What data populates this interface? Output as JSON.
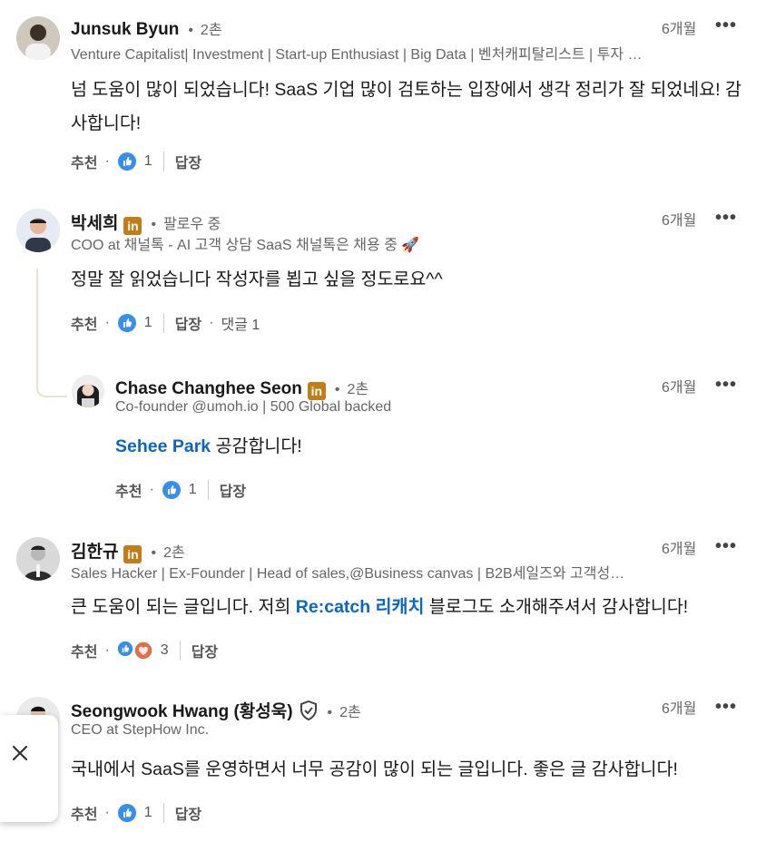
{
  "comments": [
    {
      "name": "Junsuk Byun",
      "degree": "2촌",
      "headline": "Venture Capitalist| Investment | Start-up Enthusiast | Big Data | 벤처캐피탈리스트 | 투자 |...",
      "time": "6개월",
      "body": "넘 도움이 많이 되었습니다! SaaS 기업 많이 검토하는 입장에서 생각 정리가 잘 되었네요! 감사합니다!",
      "like_label": "추천",
      "reaction_count": "1",
      "reply_label": "답장"
    },
    {
      "name": "박세희",
      "degree": "팔로우 중",
      "headline": "COO at 채널톡 - AI 고객 상담 SaaS 채널톡은 채용 중 🚀",
      "time": "6개월",
      "body": "정말 잘 읽었습니다 작성자를 뵙고 싶을 정도로요^^",
      "like_label": "추천",
      "reaction_count": "1",
      "reply_label": "답장",
      "replies_label": "댓글 1"
    },
    {
      "name": "Chase Changhee Seon",
      "degree": "2촌",
      "headline": "Co-founder @umoh.io | 500 Global backed",
      "time": "6개월",
      "mention": "Sehee Park",
      "body": " 공감합니다!",
      "like_label": "추천",
      "reaction_count": "1",
      "reply_label": "답장"
    },
    {
      "name": "김한규",
      "degree": "2촌",
      "headline": "Sales Hacker | Ex-Founder | Head of sales,@Business canvas | B2B세일즈와 고객성공...",
      "time": "6개월",
      "body_pre": "큰 도움이 되는 글입니다. 저희 ",
      "mention": "Re:catch 리캐치",
      "body": " 블로그도 소개해주셔서 감사합니다!",
      "like_label": "추천",
      "reaction_count": "3",
      "reply_label": "답장"
    },
    {
      "name": "Seongwook Hwang (황성욱)",
      "degree": "2촌",
      "headline": "CEO at StepHow Inc.",
      "time": "6개월",
      "body": "국내에서 SaaS를 운영하면서 너무 공감이 많이 되는 글입니다. 좋은 글 감사합니다!",
      "like_label": "추천",
      "reaction_count": "1",
      "reply_label": "답장"
    }
  ],
  "linkedin_badge": "in",
  "more_icon": "more-horizontal-icon",
  "close_icon": "close-icon",
  "colors": {
    "mention": "#0a66c2",
    "badge": "#c37d16",
    "text_secondary": "#666666"
  }
}
